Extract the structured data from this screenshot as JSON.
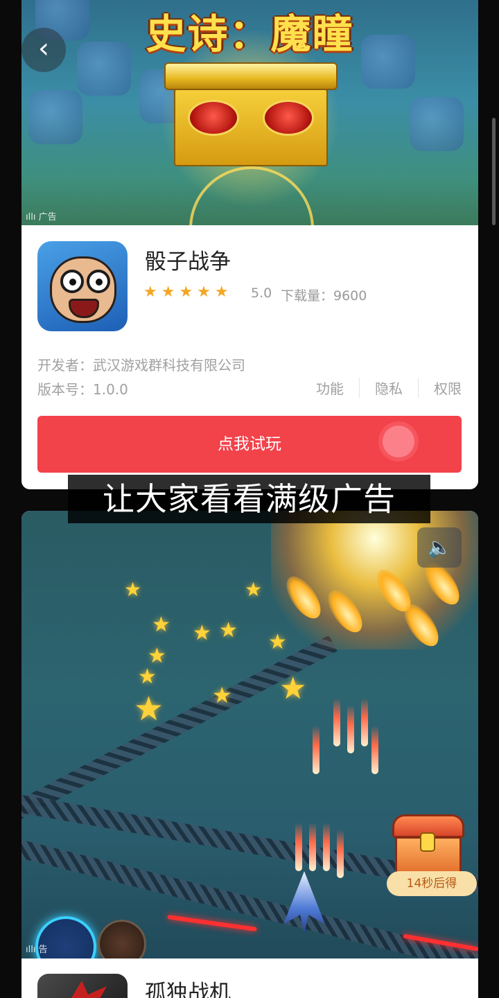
{
  "ad1": {
    "banner_title": "史诗：魔瞳",
    "ad_label": "广告",
    "app": {
      "name": "骰子战争",
      "stars": "★★★★★",
      "rating": "5.0",
      "downloads": "下载量：9600",
      "developer": "开发者：武汉游戏群科技有限公司",
      "version": "版本号：1.0.0",
      "links": [
        "功能",
        "隐私",
        "权限"
      ]
    },
    "cta": "点我试玩"
  },
  "subtitle": "让大家看看满级广告",
  "ad2": {
    "reward_timer": "14秒后得",
    "ad_label": "告",
    "app": {
      "name": "孤独战机"
    }
  },
  "icons": {
    "back": "chevron-left-icon",
    "sound": "speaker-icon"
  },
  "colors": {
    "cta": "#f2424a",
    "stars": "#f5a623",
    "timer_text": "#b65a12"
  }
}
